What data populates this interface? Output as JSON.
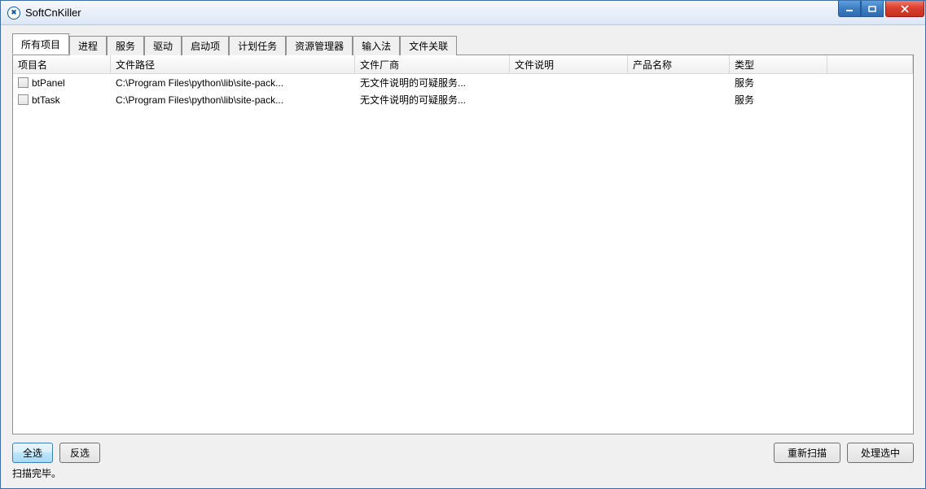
{
  "window": {
    "title": "SoftCnKiller"
  },
  "tabs": [
    {
      "label": "所有项目",
      "active": true
    },
    {
      "label": "进程",
      "active": false
    },
    {
      "label": "服务",
      "active": false
    },
    {
      "label": "驱动",
      "active": false
    },
    {
      "label": "启动项",
      "active": false
    },
    {
      "label": "计划任务",
      "active": false
    },
    {
      "label": "资源管理器",
      "active": false
    },
    {
      "label": "输入法",
      "active": false
    },
    {
      "label": "文件关联",
      "active": false
    }
  ],
  "columns": {
    "name": "项目名",
    "path": "文件路径",
    "vendor": "文件厂商",
    "desc": "文件说明",
    "prod": "产品名称",
    "type": "类型"
  },
  "rows": [
    {
      "checked": false,
      "name": "btPanel",
      "path": "C:\\Program Files\\python\\lib\\site-pack...",
      "vendor": "无文件说明的可疑服务...",
      "desc": "",
      "prod": "",
      "type": "服务"
    },
    {
      "checked": false,
      "name": "btTask",
      "path": "C:\\Program Files\\python\\lib\\site-pack...",
      "vendor": "无文件说明的可疑服务...",
      "desc": "",
      "prod": "",
      "type": "服务"
    }
  ],
  "buttons": {
    "select_all": "全选",
    "invert": "反选",
    "rescan": "重新扫描",
    "process": "处理选中"
  },
  "status": "扫描完毕。"
}
